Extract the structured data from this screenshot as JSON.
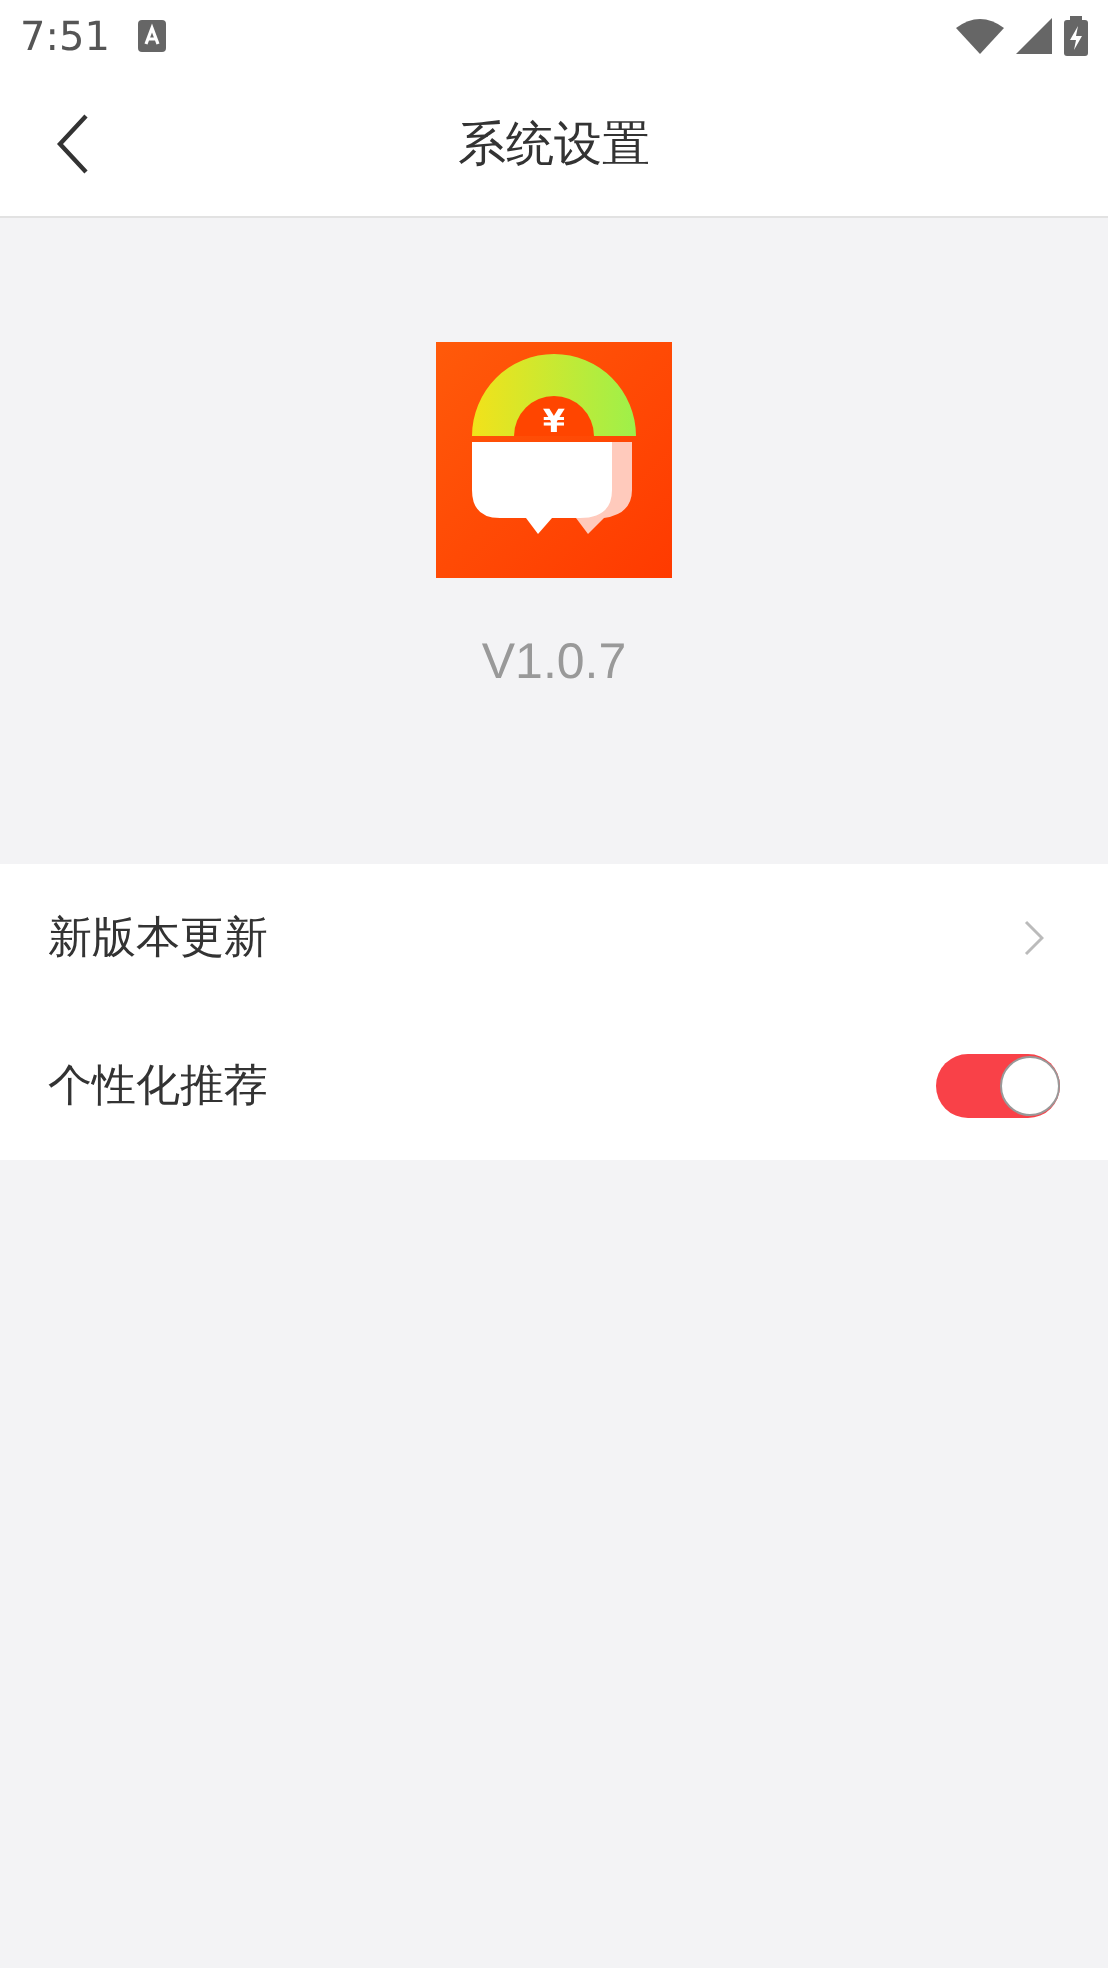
{
  "status_bar": {
    "time": "7:51"
  },
  "header": {
    "title": "系统设置"
  },
  "app_info": {
    "logo_symbol": "¥",
    "version": "V1.0.7"
  },
  "settings": [
    {
      "kind": "link",
      "label": "新版本更新"
    },
    {
      "kind": "toggle",
      "label": "个性化推荐",
      "on": true
    }
  ]
}
